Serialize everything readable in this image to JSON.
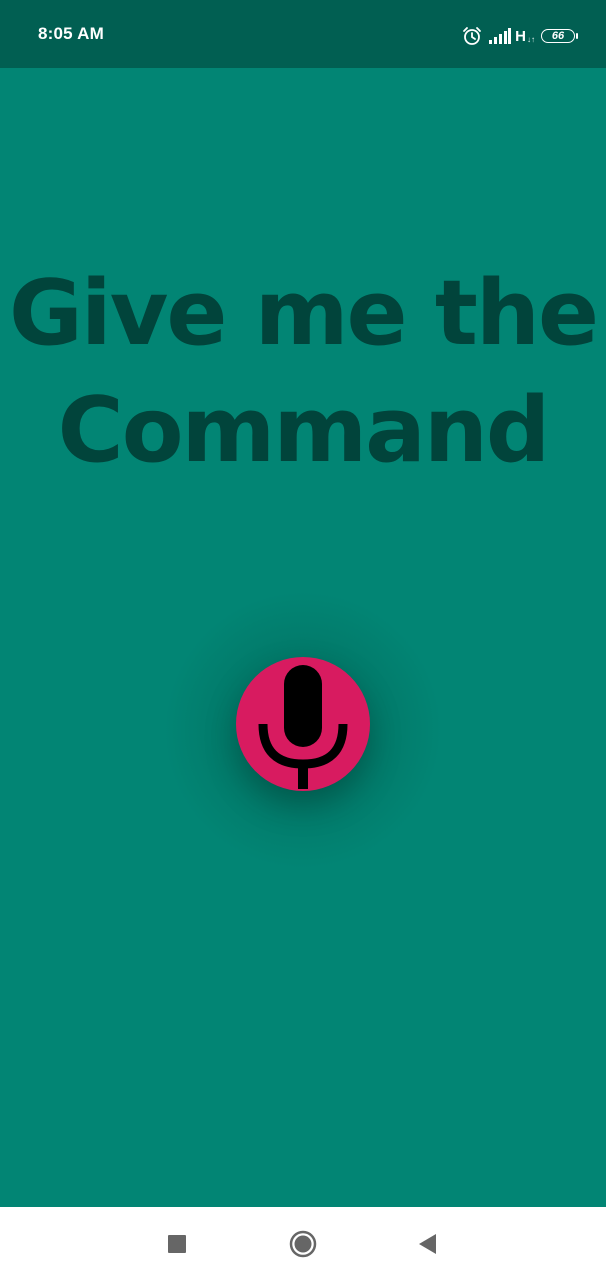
{
  "status_bar": {
    "time": "8:05 AM",
    "network_type": "H",
    "network_sub": "↓↑",
    "battery_level": "66",
    "icons": [
      "alarm-icon",
      "signal-icon",
      "battery-icon"
    ]
  },
  "main": {
    "headline_line1": "Give me the",
    "headline_line2": "Command",
    "mic_button": {
      "icon": "microphone-icon",
      "color": "#d81b60"
    }
  },
  "nav_bar": {
    "buttons": [
      "recents",
      "home",
      "back"
    ]
  },
  "colors": {
    "background": "#028574",
    "status_bar": "#015f52",
    "headline": "#01443b",
    "accent": "#d81b60"
  }
}
